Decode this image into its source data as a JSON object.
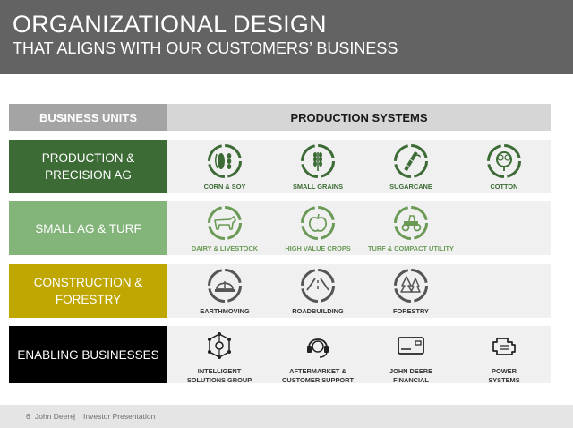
{
  "header": {
    "title": "ORGANIZATIONAL DESIGN",
    "subtitle": "THAT ALIGNS WITH OUR CUSTOMERS’ BUSINESS"
  },
  "columns": {
    "business_units": "BUSINESS UNITS",
    "production_systems": "PRODUCTION SYSTEMS"
  },
  "rows": [
    {
      "unit_line1": "PRODUCTION &",
      "unit_line2": "PRECISION AG",
      "color": "#3c6b36",
      "items": [
        {
          "label": "CORN & SOY",
          "icon": "corn-soy-icon"
        },
        {
          "label": "SMALL GRAINS",
          "icon": "wheat-icon"
        },
        {
          "label": "SUGARCANE",
          "icon": "sugarcane-icon"
        },
        {
          "label": "COTTON",
          "icon": "cotton-icon"
        }
      ]
    },
    {
      "unit_line1": "SMALL AG & TURF",
      "unit_line2": "",
      "color": "#83b57a",
      "items": [
        {
          "label": "DAIRY & LIVESTOCK",
          "icon": "cow-icon"
        },
        {
          "label": "HIGH VALUE CROPS",
          "icon": "apple-icon"
        },
        {
          "label": "TURF & COMPACT UTILITY",
          "icon": "tractor-icon"
        }
      ]
    },
    {
      "unit_line1": "CONSTRUCTION &",
      "unit_line2": "FORESTRY",
      "color": "#bfa700",
      "items": [
        {
          "label": "EARTHMOVING",
          "icon": "hard-hat-icon"
        },
        {
          "label": "ROADBUILDING",
          "icon": "road-icon"
        },
        {
          "label": "FORESTRY",
          "icon": "trees-icon"
        }
      ]
    },
    {
      "unit_line1": "ENABLING BUSINESSES",
      "unit_line2": "",
      "color": "#000000",
      "items": [
        {
          "label1": "INTELLIGENT",
          "label2": "SOLUTIONS GROUP",
          "icon": "network-icon"
        },
        {
          "label1": "AFTERMARKET &",
          "label2": "CUSTOMER SUPPORT",
          "icon": "headset-icon"
        },
        {
          "label1": "JOHN DEERE",
          "label2": "FINANCIAL",
          "icon": "credit-card-icon"
        },
        {
          "label1": "POWER",
          "label2": "SYSTEMS",
          "icon": "engine-icon"
        }
      ]
    }
  ],
  "footer": {
    "page": "6",
    "company": "John Deere",
    "separator": "|",
    "doc": "Investor Presentation"
  }
}
